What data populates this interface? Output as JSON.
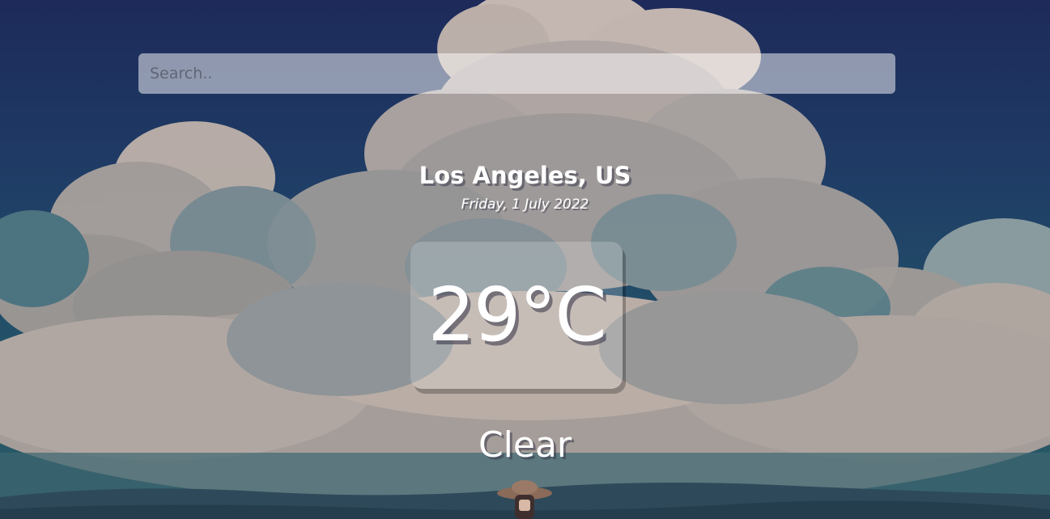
{
  "search": {
    "placeholder": "Search..",
    "value": ""
  },
  "location": {
    "name": "Los Angeles, US",
    "date": "Friday, 1 July 2022"
  },
  "weather": {
    "temperature": "29°C",
    "condition": "Clear"
  },
  "background": {
    "description_icon": "sky-with-clouds-illustration",
    "colors": {
      "sky_top": "#1e2d5c",
      "sky_mid": "#24506a",
      "cloud_light": "#c9bdb3",
      "cloud_shadow": "#6f8c92",
      "hills": "#2c4a5a"
    }
  }
}
